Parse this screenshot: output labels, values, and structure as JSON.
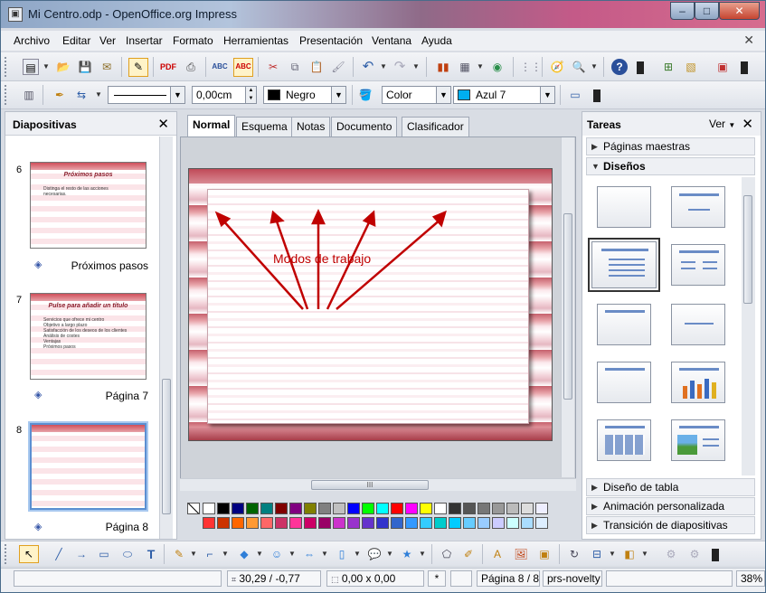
{
  "window": {
    "title": "Mi Centro.odp - OpenOffice.org Impress",
    "minimize": "–",
    "maximize": "□",
    "close": "✕"
  },
  "menu": {
    "items": [
      {
        "label": "Archivo"
      },
      {
        "label": "Editar"
      },
      {
        "label": "Ver"
      },
      {
        "label": "Insertar"
      },
      {
        "label": "Formato"
      },
      {
        "label": "Herramientas"
      },
      {
        "label": "Presentación"
      },
      {
        "label": "Ventana"
      },
      {
        "label": "Ayuda"
      }
    ],
    "close": "✕"
  },
  "toolbar2": {
    "line_width": "0,00cm",
    "line_color": "Negro",
    "line_color_hex": "#000000",
    "fill_type": "Color",
    "fill_color": "Azul 7",
    "fill_color_hex": "#00aeef"
  },
  "slides_panel": {
    "title": "Diapositivas",
    "close": "✕",
    "slides": [
      {
        "number": "6",
        "name": "Próximos pasos",
        "thumb_title": "Próximos pasos",
        "bullets": [
          "Distinga el resto de las acciones",
          "necesarias."
        ]
      },
      {
        "number": "7",
        "name": "Página 7",
        "thumb_title": "Pulse para añadir un título",
        "bullets": [
          "Servicios que ofrece mi centro",
          "Objetivo a largo plazo",
          "Satisfacción de los deseos de los clientes",
          "Análisis de costes",
          "Ventajas",
          "Próximos pasos"
        ]
      },
      {
        "number": "8",
        "name": "Página 8",
        "thumb_title": "",
        "bullets": []
      }
    ]
  },
  "view_tabs": [
    {
      "label": "Normal",
      "active": true
    },
    {
      "label": "Esquema",
      "active": false
    },
    {
      "label": "Notas",
      "active": false
    },
    {
      "label": "Documento",
      "active": false
    },
    {
      "label": "Clasificador de diapositivas",
      "active": false
    }
  ],
  "annotation": "Modos de trabajo",
  "annotation_color": "#c00000",
  "hscroll_grip": "III",
  "tasks_panel": {
    "title": "Tareas",
    "view_label": "Ver",
    "close": "✕",
    "sections_top": [
      {
        "label": "Páginas maestras",
        "expanded": false
      },
      {
        "label": "Diseños",
        "expanded": true
      }
    ],
    "sections_bottom": [
      {
        "label": "Diseño de tabla"
      },
      {
        "label": "Animación personalizada"
      },
      {
        "label": "Transición de diapositivas"
      }
    ]
  },
  "status": {
    "position": "30,29 / -0,77",
    "size": "0,00 x 0,00",
    "modified": "*",
    "page": "Página 8 / 8",
    "master": "prs-novelty",
    "zoom": "38%"
  },
  "palette_colors": [
    "#ffffff",
    "#000000",
    "#000080",
    "#006400",
    "#008080",
    "#800000",
    "#800080",
    "#808000",
    "#808080",
    "#c0c0c0",
    "#0000ff",
    "#00ff00",
    "#00ffff",
    "#ff0000",
    "#ff00ff",
    "#ffff00",
    "#ffffff",
    "#333333",
    "#555555",
    "#777777",
    "#999999",
    "#bbbbbb",
    "#dddddd",
    "#eeeeff",
    "#ff3333",
    "#cc3300",
    "#ff6600",
    "#ff9933",
    "#ff6666",
    "#cc3366",
    "#ff3399",
    "#cc0066",
    "#990066",
    "#cc33cc",
    "#9933cc",
    "#6633cc",
    "#3333cc",
    "#3366cc",
    "#3399ff",
    "#33ccff",
    "#00cccc",
    "#00ccff",
    "#66ccff",
    "#99ccff",
    "#ccccff",
    "#ccffff",
    "#aaddff",
    "#ddeeff"
  ],
  "icons": [
    "new-icon",
    "open-icon",
    "save-icon",
    "email-icon",
    "edit-icon",
    "pdf-icon",
    "print-icon",
    "spellcheck-icon",
    "autospell-icon",
    "cut-icon",
    "copy-icon",
    "paste-icon",
    "clone-icon",
    "undo-icon",
    "redo-icon",
    "chart-icon",
    "table-icon",
    "presentation-icon",
    "grid-icon",
    "navigator-icon",
    "zoom-icon",
    "help-icon"
  ]
}
